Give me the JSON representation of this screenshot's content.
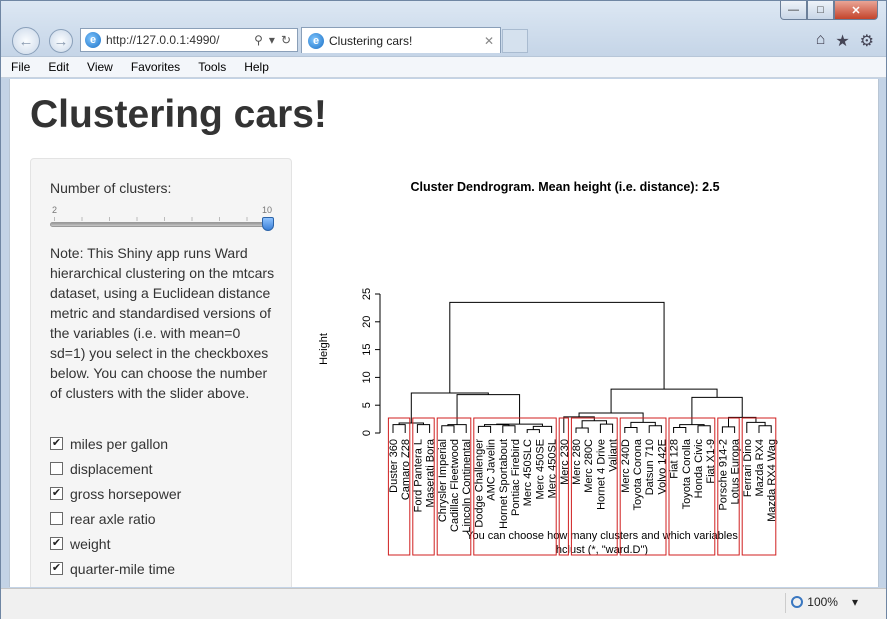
{
  "browser": {
    "address": "http://127.0.0.1:4990/",
    "tab_title": "Clustering cars!",
    "menu": [
      "File",
      "Edit",
      "View",
      "Favorites",
      "Tools",
      "Help"
    ],
    "zoom": "100%"
  },
  "page": {
    "title": "Clustering cars!",
    "slider": {
      "label": "Number of clusters:",
      "min": 2,
      "max": 10,
      "value": 10
    },
    "note": "Note: This Shiny app runs Ward hierarchical clustering on the mtcars dataset, using a Euclidean distance metric and standardised versions of the variables (i.e. with mean=0 sd=1) you select in the checkboxes below. You can choose the number of clusters with the slider above.",
    "checkboxes": [
      {
        "label": "miles per gallon",
        "checked": true
      },
      {
        "label": "displacement",
        "checked": false
      },
      {
        "label": "gross horsepower",
        "checked": true
      },
      {
        "label": "rear axle ratio",
        "checked": false
      },
      {
        "label": "weight",
        "checked": true
      },
      {
        "label": "quarter-mile time",
        "checked": true
      }
    ]
  },
  "chart_data": {
    "type": "dendrogram",
    "title": "Cluster Dendrogram. Mean height (i.e. distance): 2.5",
    "ylabel": "Height",
    "xlabel_line1": "You can choose how many clusters and which variables",
    "xlabel_line2": "hclust (*, \"ward.D\")",
    "ylim": [
      0,
      25
    ],
    "yticks": [
      0,
      5,
      10,
      15,
      20,
      25
    ],
    "leaves": [
      "Duster 360",
      "Camaro Z28",
      "Ford Pantera L",
      "Maserati Bora",
      "Chrysler Imperial",
      "Cadillac Fleetwood",
      "Lincoln Continental",
      "Dodge Challenger",
      "AMC Javelin",
      "Hornet Sportabout",
      "Pontiac Firebird",
      "Merc 450SLC",
      "Merc 450SE",
      "Merc 450SL",
      "Merc 230",
      "Merc 280",
      "Merc 280C",
      "Hornet 4 Drive",
      "Valiant",
      "Merc 240D",
      "Toyota Corona",
      "Datsun 710",
      "Volvo 142E",
      "Fiat 128",
      "Toyota Corolla",
      "Honda Civic",
      "Fiat X1-9",
      "Porsche 914-2",
      "Lotus Europa",
      "Ferrari Dino",
      "Mazda RX4",
      "Mazda RX4 Wag"
    ],
    "merges": [
      {
        "l": 0,
        "r": 1,
        "h": 1.5
      },
      {
        "l": 2,
        "r": 3,
        "h": 1.5
      },
      {
        "l": 4,
        "r": 5,
        "h": 1.3
      },
      {
        "l": -3,
        "r": 6,
        "h": 1.5
      },
      {
        "l": 7,
        "r": 8,
        "h": 1.2
      },
      {
        "l": 9,
        "r": 10,
        "h": 1.3
      },
      {
        "l": -5,
        "r": -6,
        "h": 1.5
      },
      {
        "l": 11,
        "r": 12,
        "h": 0.6
      },
      {
        "l": -8,
        "r": 13,
        "h": 1.2
      },
      {
        "l": -7,
        "r": -9,
        "h": 1.6
      },
      {
        "l": -1,
        "r": -2,
        "h": 1.8
      },
      {
        "l": -4,
        "r": -10,
        "h": 6.9
      },
      {
        "l": -11,
        "r": -12,
        "h": 7.2
      },
      {
        "l": 15,
        "r": 16,
        "h": 0.9
      },
      {
        "l": 17,
        "r": 18,
        "h": 1.6
      },
      {
        "l": -14,
        "r": -15,
        "h": 2.2
      },
      {
        "l": 14,
        "r": -16,
        "h": 2.9
      },
      {
        "l": 19,
        "r": 20,
        "h": 1.0
      },
      {
        "l": 21,
        "r": 22,
        "h": 1.3
      },
      {
        "l": -18,
        "r": -19,
        "h": 1.9
      },
      {
        "l": -17,
        "r": -20,
        "h": 3.6
      },
      {
        "l": 23,
        "r": 24,
        "h": 1.0
      },
      {
        "l": 25,
        "r": 26,
        "h": 1.3
      },
      {
        "l": -22,
        "r": -23,
        "h": 1.5
      },
      {
        "l": 27,
        "r": 28,
        "h": 1.1
      },
      {
        "l": 30,
        "r": 31,
        "h": 1.3
      },
      {
        "l": 29,
        "r": -26,
        "h": 1.9
      },
      {
        "l": -25,
        "r": -27,
        "h": 2.8
      },
      {
        "l": -24,
        "r": -28,
        "h": 6.4
      },
      {
        "l": -21,
        "r": -29,
        "h": 7.9
      },
      {
        "l": -13,
        "r": -30,
        "h": 23.5
      }
    ],
    "clusters": [
      [
        0,
        1
      ],
      [
        2,
        3
      ],
      [
        4,
        6
      ],
      [
        7,
        13
      ],
      [
        14,
        14
      ],
      [
        15,
        18
      ],
      [
        19,
        22
      ],
      [
        23,
        26
      ],
      [
        27,
        28
      ],
      [
        29,
        31
      ]
    ]
  }
}
